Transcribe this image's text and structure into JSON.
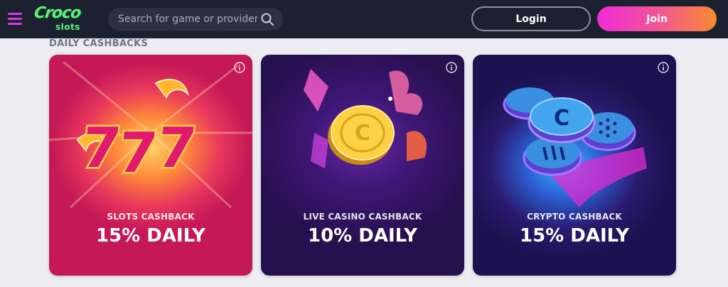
{
  "header": {
    "logo": {
      "main": "Croco",
      "sub": "slots"
    },
    "search": {
      "placeholder": "Search for game or provider"
    },
    "login_label": "Login",
    "join_label": "Join"
  },
  "icons": {
    "menu": "hamburger-icon",
    "search": "search-icon",
    "info": "info-icon"
  },
  "colors": {
    "accent": "#d63be0",
    "logo_green": "#5ef27a",
    "header_bg": "#1c2130",
    "join_gradient": [
      "#ee2bd8",
      "#f78b2f"
    ]
  },
  "section": {
    "title": "DAILY CASHBACKS"
  },
  "cards": [
    {
      "label": "SLOTS CASHBACK",
      "value": "15% DAILY"
    },
    {
      "label": "LIVE CASINO CASHBACK",
      "value": "10% DAILY"
    },
    {
      "label": "CRYPTO CASHBACK",
      "value": "15% DAILY"
    }
  ]
}
